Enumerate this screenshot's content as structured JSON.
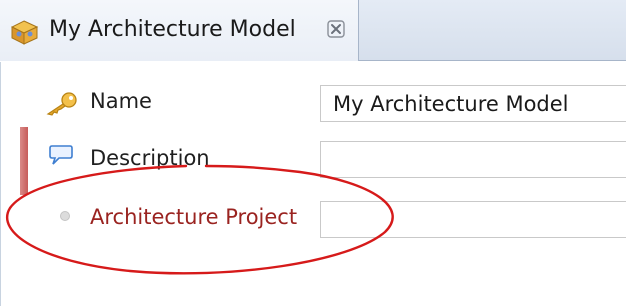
{
  "editor_tab": {
    "title": "My Architecture Model",
    "icon": "model-package-icon",
    "close_icon": "close-icon"
  },
  "fields": {
    "name": {
      "label": "Name",
      "value": "My Architecture Model",
      "icon": "key-icon"
    },
    "description": {
      "label": "Description",
      "value": "",
      "icon": "speech-bubble-icon"
    },
    "architecture_project": {
      "label": "Architecture Project",
      "value": "",
      "icon": "dot-icon",
      "required": true
    }
  },
  "colors": {
    "required_label": "#9a2320",
    "annotation_ellipse": "#d61a1a",
    "tab_background": "#e9eef6"
  },
  "annotation": "red-ellipse-highlight"
}
